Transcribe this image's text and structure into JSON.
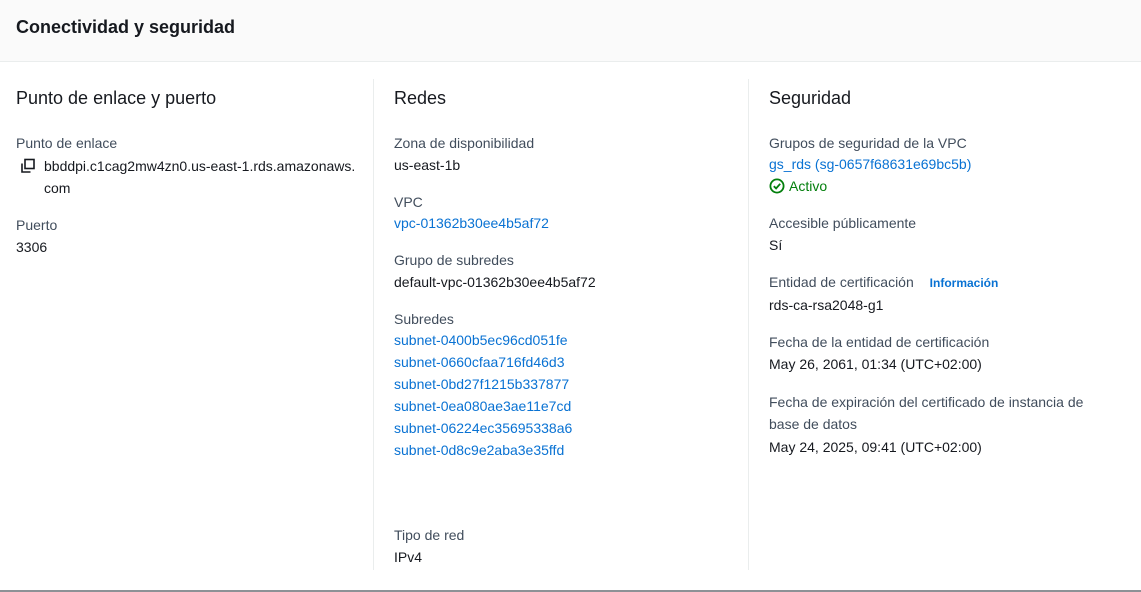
{
  "panel": {
    "title": "Conectividad y seguridad"
  },
  "col1": {
    "title": "Punto de enlace y puerto",
    "endpoint_label": "Punto de enlace",
    "endpoint_value": "bbddpi.c1cag2mw4zn0.us-east-1.rds.amazonaws.com",
    "port_label": "Puerto",
    "port_value": "3306"
  },
  "col2": {
    "title": "Redes",
    "az_label": "Zona de disponibilidad",
    "az_value": "us-east-1b",
    "vpc_label": "VPC",
    "vpc_value": "vpc-01362b30ee4b5af72",
    "subnet_group_label": "Grupo de subredes",
    "subnet_group_value": "default-vpc-01362b30ee4b5af72",
    "subnets_label": "Subredes",
    "subnets": [
      "subnet-0400b5ec96cd051fe",
      "subnet-0660cfaa716fd46d3",
      "subnet-0bd27f1215b337877",
      "subnet-0ea080ae3ae11e7cd",
      "subnet-06224ec35695338a6",
      "subnet-0d8c9e2aba3e35ffd"
    ],
    "network_type_label": "Tipo de red",
    "network_type_value": "IPv4"
  },
  "col3": {
    "title": "Seguridad",
    "sg_label": "Grupos de seguridad de la VPC",
    "sg_value": "gs_rds (sg-0657f68631e69bc5b)",
    "sg_status": "Activo",
    "public_label": "Accesible públicamente",
    "public_value": "Sí",
    "ca_label": "Entidad de certificación",
    "ca_info": "Información",
    "ca_value": "rds-ca-rsa2048-g1",
    "ca_date_label": "Fecha de la entidad de certificación",
    "ca_date_value": "May 26, 2061, 01:34 (UTC+02:00)",
    "cert_exp_label": "Fecha de expiración del certificado de instancia de base de datos",
    "cert_exp_value": "May 24, 2025, 09:41 (UTC+02:00)"
  },
  "colors": {
    "link": "#0972d3",
    "success": "#037f0c",
    "text": "#16191f",
    "label": "#414d5c"
  }
}
